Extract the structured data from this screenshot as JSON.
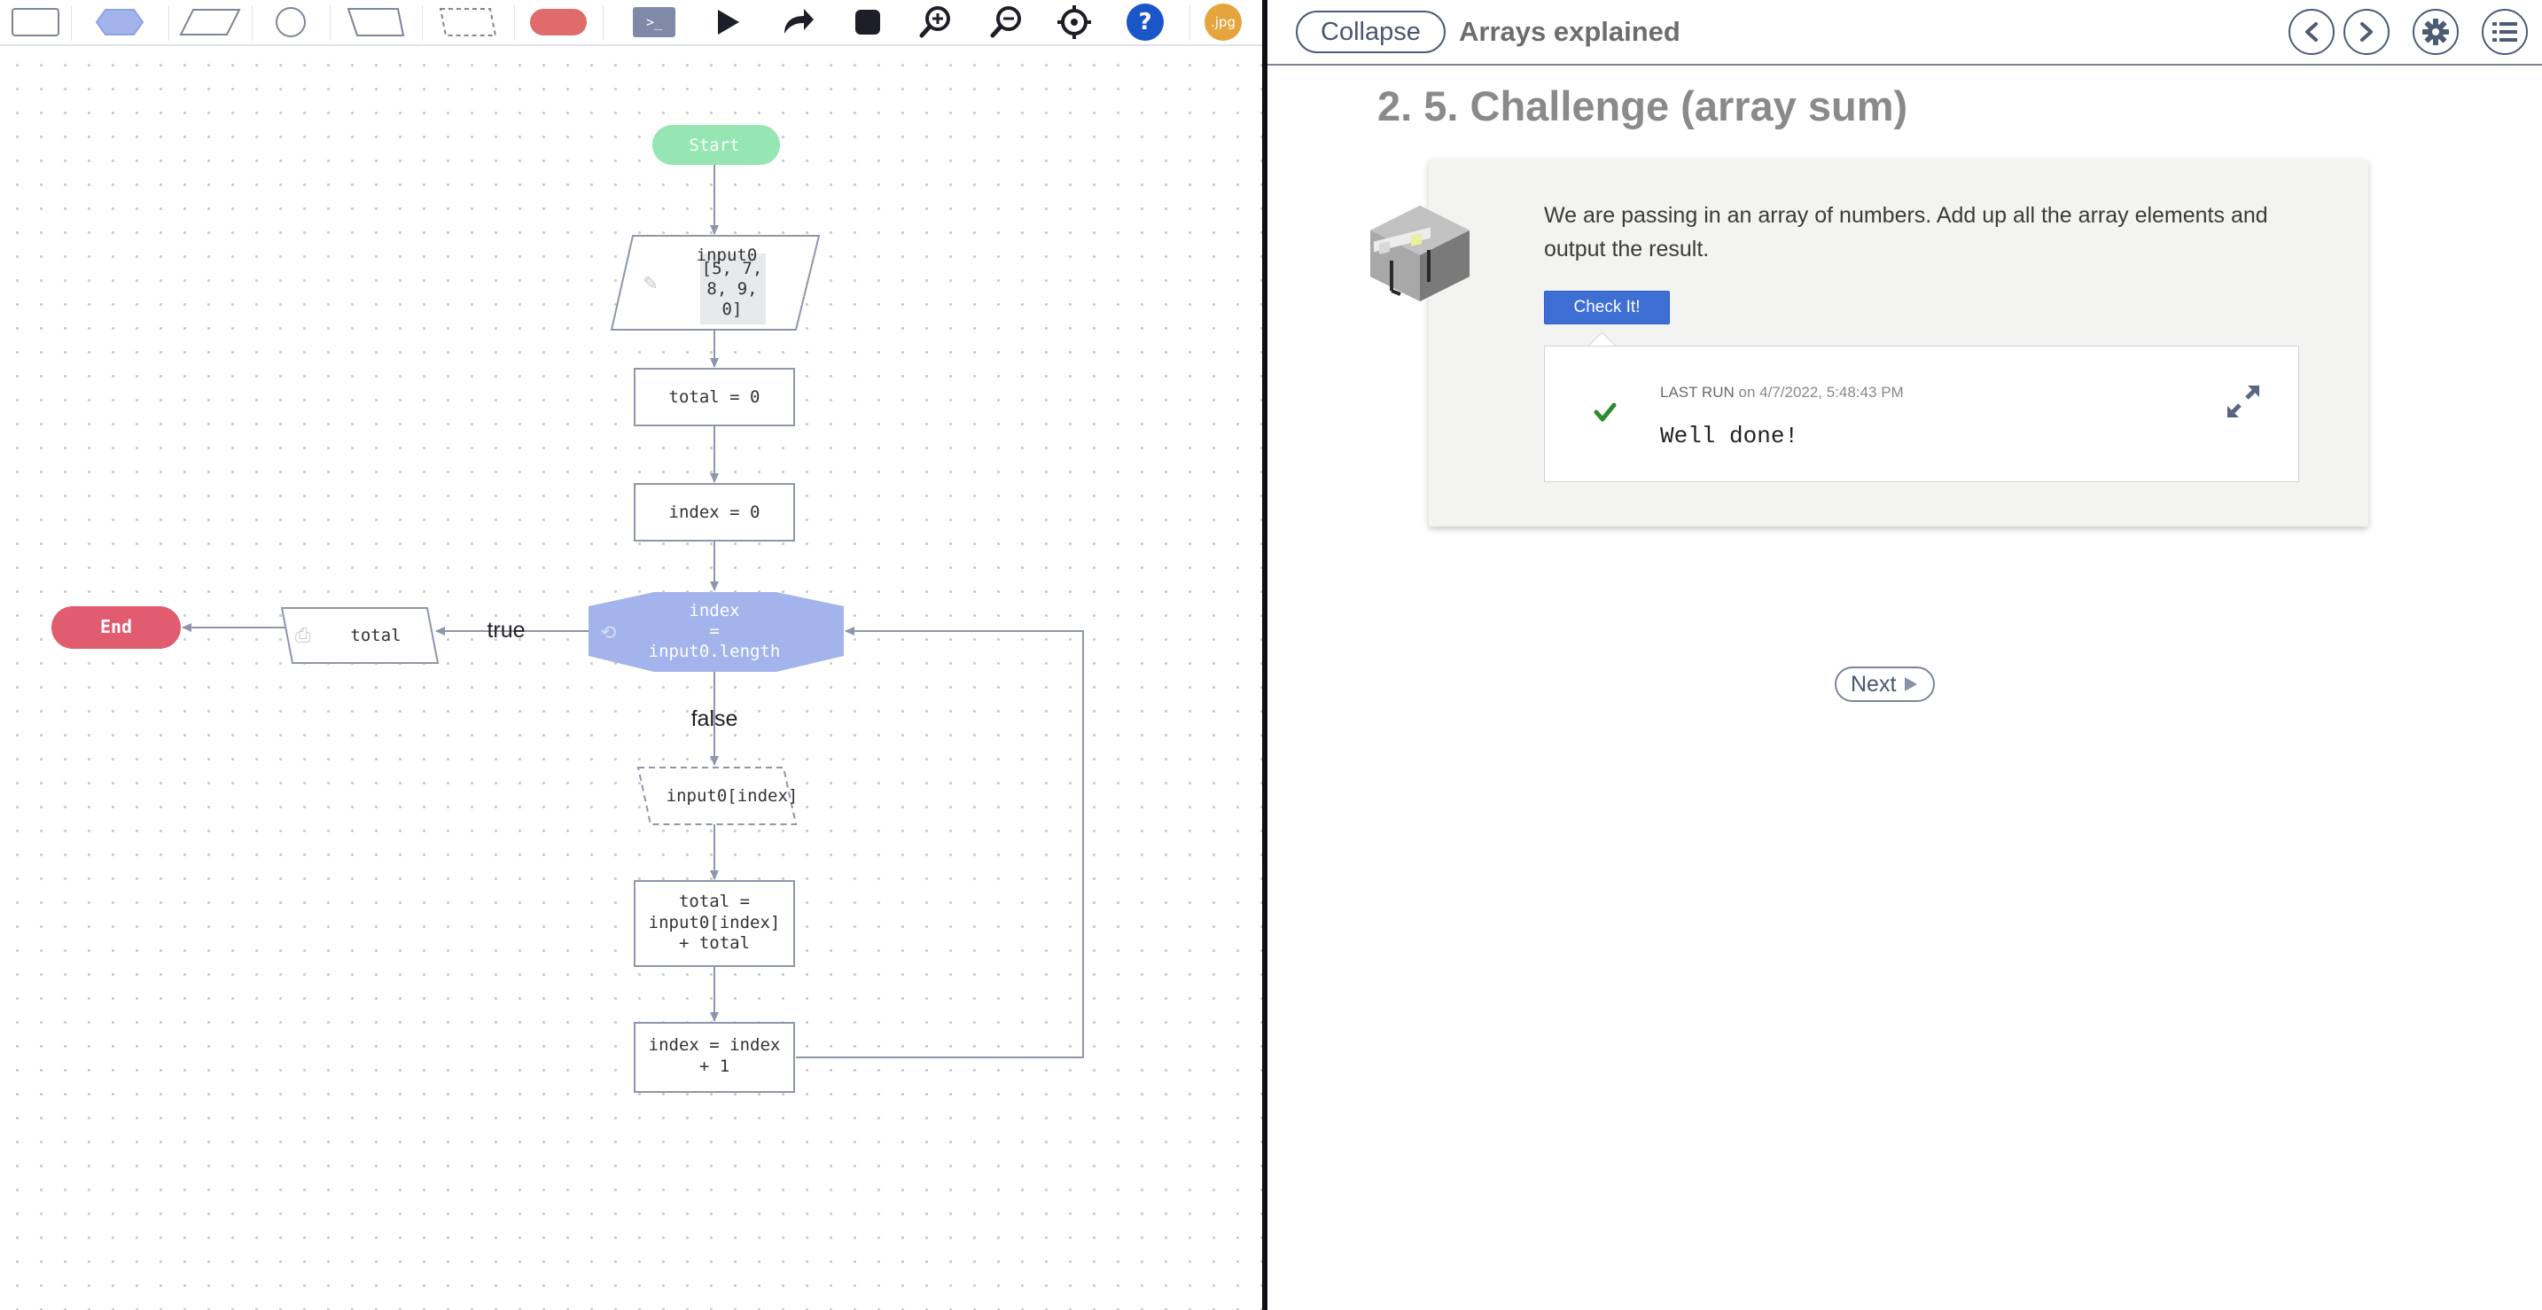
{
  "editor": {
    "toolbar": {
      "tools": [
        {
          "name": "process-tool"
        },
        {
          "name": "decision-tool"
        },
        {
          "name": "input-output-tool"
        },
        {
          "name": "connector-tool"
        },
        {
          "name": "manual-input-tool"
        },
        {
          "name": "comment-tool"
        },
        {
          "name": "terminal-tool"
        }
      ],
      "actions": [
        {
          "name": "console-button",
          "glyph": ">_"
        },
        {
          "name": "run-button"
        },
        {
          "name": "step-button"
        },
        {
          "name": "stop-button"
        },
        {
          "name": "zoom-in-button"
        },
        {
          "name": "zoom-out-button"
        },
        {
          "name": "center-button"
        },
        {
          "name": "help-button",
          "glyph": "?"
        },
        {
          "name": "export-image-button",
          "glyph": ".jpg"
        }
      ]
    },
    "flowchart": {
      "start": "Start",
      "input_var": "input0",
      "input_value_lines": [
        "[5, 7,",
        "8, 9,",
        "0]"
      ],
      "total_init": "total = 0",
      "index_init": "index = 0",
      "decision_lines": [
        "index",
        "=",
        "input0.length"
      ],
      "true_label": "true",
      "false_label": "false",
      "output_var": "total",
      "end": "End",
      "comment": "input0[index]",
      "sum_lines": [
        "total =",
        "input0[index]",
        "+ total"
      ],
      "increment_lines": [
        "index = index",
        "+ 1"
      ]
    }
  },
  "lesson": {
    "collapse_label": "Collapse",
    "title": "Arrays explained",
    "section_title": "2. 5. Challenge (array sum)",
    "prompt": "We are passing in an array of numbers. Add up all the array elements and output the result.",
    "check_button": "Check It!",
    "last_run_label": "LAST RUN",
    "last_run_time": "on 4/7/2022, 5:48:43 PM",
    "result_message": "Well done!",
    "next_label": "Next"
  },
  "colors": {
    "start_node": "#96e6b3",
    "end_node": "#e05c6e",
    "decision_node": "#a3b4ec",
    "line": "#8f95ad",
    "accent_blue": "#3d6fd4",
    "success_green": "#2e8b2e"
  }
}
